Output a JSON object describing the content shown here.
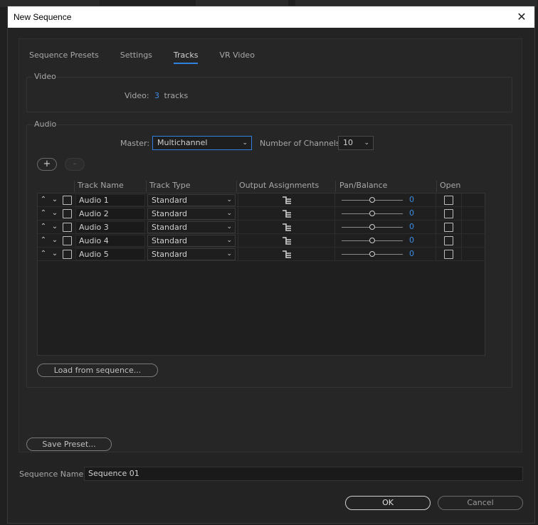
{
  "window": {
    "title": "New Sequence",
    "close_glyph": "✕"
  },
  "tabs": [
    {
      "label": "Sequence Presets",
      "active": false
    },
    {
      "label": "Settings",
      "active": false
    },
    {
      "label": "Tracks",
      "active": true
    },
    {
      "label": "VR Video",
      "active": false
    }
  ],
  "video": {
    "group_label": "Video",
    "label": "Video:",
    "count": "3",
    "unit": "tracks"
  },
  "audio": {
    "group_label": "Audio",
    "master_label": "Master:",
    "master_value": "Multichannel",
    "channels_label": "Number of Channels:",
    "channels_value": "10",
    "add_glyph": "+",
    "remove_glyph": "-",
    "columns": [
      "Track Name",
      "Track Type",
      "Output Assignments",
      "Pan/Balance",
      "Open"
    ],
    "tracks": [
      {
        "name": "Audio 1",
        "type": "Standard",
        "pan": "0"
      },
      {
        "name": "Audio 2",
        "type": "Standard",
        "pan": "0"
      },
      {
        "name": "Audio 3",
        "type": "Standard",
        "pan": "0"
      },
      {
        "name": "Audio 4",
        "type": "Standard",
        "pan": "0"
      },
      {
        "name": "Audio 5",
        "type": "Standard",
        "pan": "0"
      }
    ],
    "load_button": "Load from sequence..."
  },
  "save_preset_button": "Save Preset...",
  "sequence_name": {
    "label": "Sequence Name:",
    "value": "Sequence 01"
  },
  "buttons": {
    "ok": "OK",
    "cancel": "Cancel"
  },
  "colors": {
    "accent": "#2f82dd",
    "value_blue": "#3a8de5",
    "background": "#232323"
  }
}
